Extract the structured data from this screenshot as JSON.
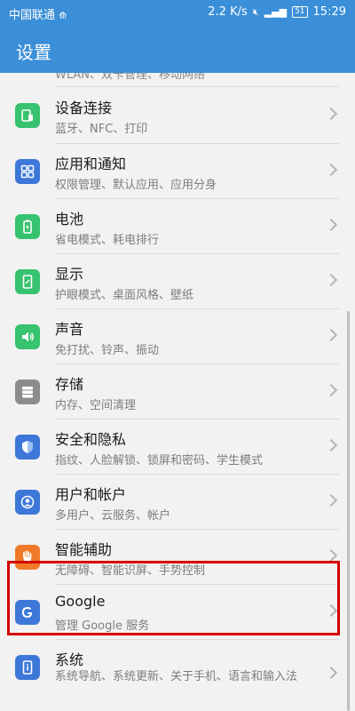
{
  "status_bar": {
    "carrier": "中国联通",
    "speed": "2.2 K/s",
    "battery": "51",
    "time": "15:29"
  },
  "header": {
    "title": "设置"
  },
  "partial_item": {
    "subtitle": "WLAN、双卡管理、移动网络"
  },
  "items": [
    {
      "title": "设备连接",
      "subtitle": "蓝牙、NFC、打印",
      "icon": "device-connection-icon",
      "color": "#36c26e"
    },
    {
      "title": "应用和通知",
      "subtitle": "权限管理、默认应用、应用分身",
      "icon": "apps-icon",
      "color": "#3d77d8"
    },
    {
      "title": "电池",
      "subtitle": "省电模式、耗电排行",
      "icon": "battery-icon",
      "color": "#36c26e"
    },
    {
      "title": "显示",
      "subtitle": "护眼模式、桌面风格、壁纸",
      "icon": "display-icon",
      "color": "#36c26e"
    },
    {
      "title": "声音",
      "subtitle": "免打扰、铃声、振动",
      "icon": "sound-icon",
      "color": "#36c26e"
    },
    {
      "title": "存储",
      "subtitle": "内存、空间清理",
      "icon": "storage-icon",
      "color": "#8c8c8c"
    },
    {
      "title": "安全和隐私",
      "subtitle": "指纹、人脸解锁、锁屏和密码、学生模式",
      "icon": "shield-icon",
      "color": "#3d77d8"
    },
    {
      "title": "用户和帐户",
      "subtitle": "多用户、云服务、帐户",
      "icon": "user-icon",
      "color": "#3d77d8"
    },
    {
      "title": "智能辅助",
      "subtitle": "无障碍、智能识屏、手势控制",
      "icon": "hand-icon",
      "color": "#f07a2a"
    },
    {
      "title": "Google",
      "subtitle": "管理 Google 服务",
      "icon": "google-icon",
      "color": "#3d77d8"
    },
    {
      "title": "系统",
      "subtitle": "系统导航、系统更新、关于手机、语言和输入法",
      "icon": "system-info-icon",
      "color": "#3d77d8"
    }
  ]
}
